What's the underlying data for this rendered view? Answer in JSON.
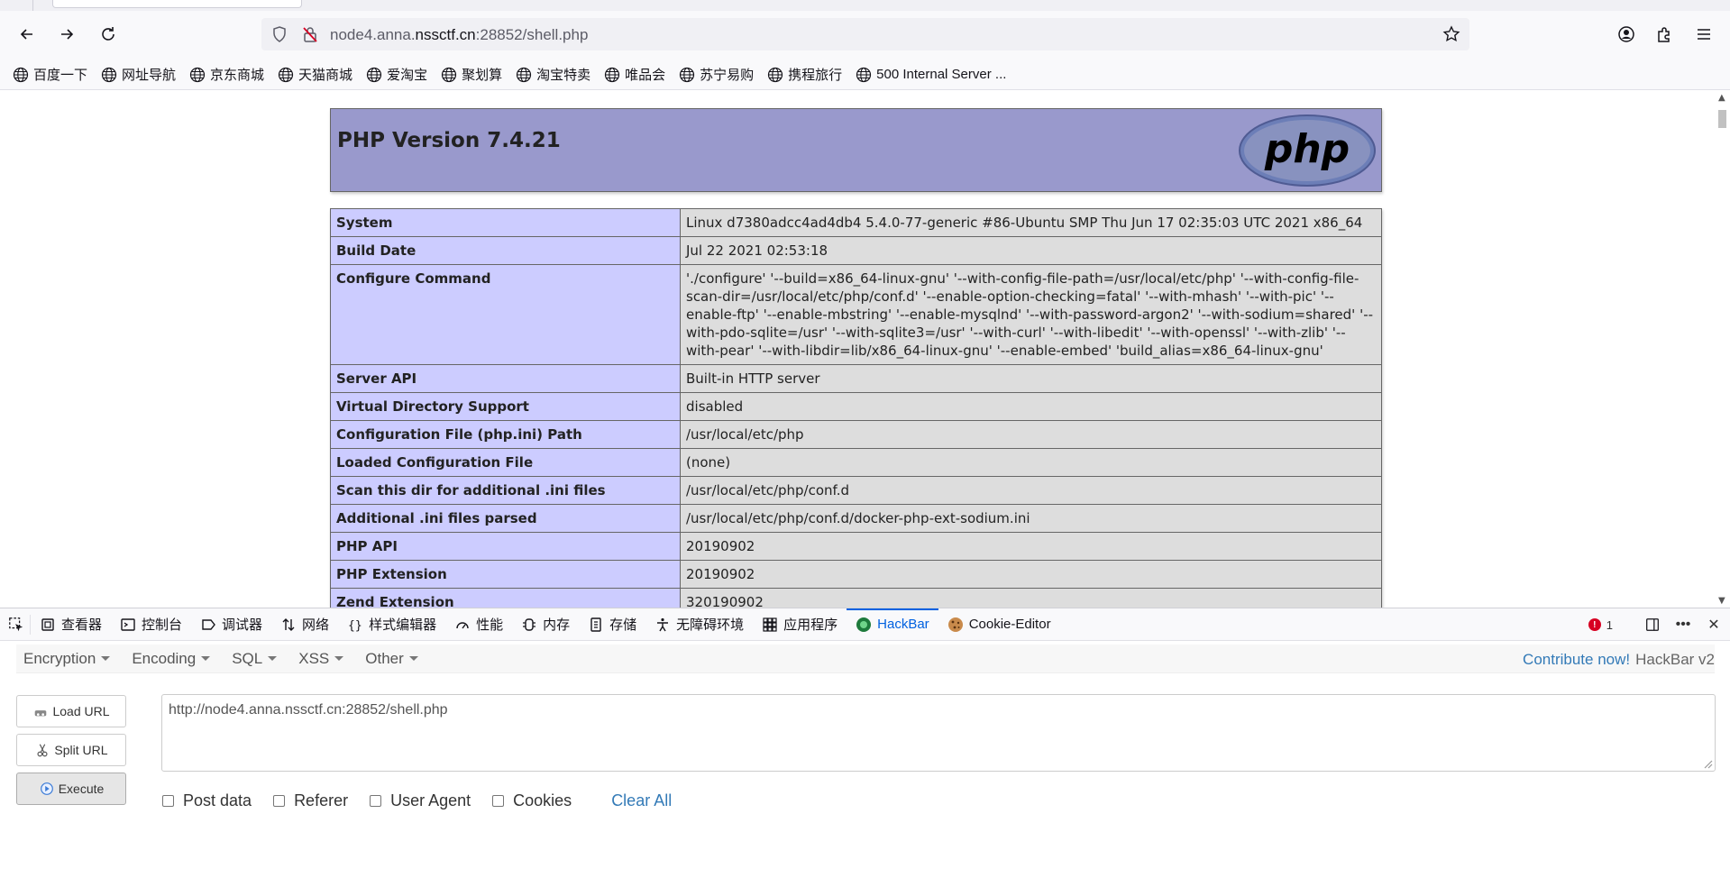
{
  "browser": {
    "url_prefix": "node4.anna.",
    "url_domain": "nssctf.cn",
    "url_suffix": ":28852/shell.php",
    "bookmarks": [
      "百度一下",
      "网址导航",
      "京东商城",
      "天猫商城",
      "爱淘宝",
      "聚划算",
      "淘宝特卖",
      "唯品会",
      "苏宁易购",
      "携程旅行",
      "500 Internal Server ..."
    ]
  },
  "phpinfo": {
    "title": "PHP Version 7.4.21",
    "logo_text": "php",
    "rows": [
      {
        "key": "System",
        "value": "Linux d7380adcc4ad4db4 5.4.0-77-generic #86-Ubuntu SMP Thu Jun 17 02:35:03 UTC 2021 x86_64"
      },
      {
        "key": "Build Date",
        "value": "Jul 22 2021 02:53:18"
      },
      {
        "key": "Configure Command",
        "value": "'./configure' '--build=x86_64-linux-gnu' '--with-config-file-path=/usr/local/etc/php' '--with-config-file-scan-dir=/usr/local/etc/php/conf.d' '--enable-option-checking=fatal' '--with-mhash' '--with-pic' '--enable-ftp' '--enable-mbstring' '--enable-mysqlnd' '--with-password-argon2' '--with-sodium=shared' '--with-pdo-sqlite=/usr' '--with-sqlite3=/usr' '--with-curl' '--with-libedit' '--with-openssl' '--with-zlib' '--with-pear' '--with-libdir=lib/x86_64-linux-gnu' '--enable-embed' 'build_alias=x86_64-linux-gnu'"
      },
      {
        "key": "Server API",
        "value": "Built-in HTTP server"
      },
      {
        "key": "Virtual Directory Support",
        "value": "disabled"
      },
      {
        "key": "Configuration File (php.ini) Path",
        "value": "/usr/local/etc/php"
      },
      {
        "key": "Loaded Configuration File",
        "value": "(none)"
      },
      {
        "key": "Scan this dir for additional .ini files",
        "value": "/usr/local/etc/php/conf.d"
      },
      {
        "key": "Additional .ini files parsed",
        "value": "/usr/local/etc/php/conf.d/docker-php-ext-sodium.ini"
      },
      {
        "key": "PHP API",
        "value": "20190902"
      },
      {
        "key": "PHP Extension",
        "value": "20190902"
      },
      {
        "key": "Zend Extension",
        "value": "320190902"
      }
    ]
  },
  "devtools": {
    "tabs": [
      {
        "label": "查看器",
        "icon": "inspector-icon"
      },
      {
        "label": "控制台",
        "icon": "console-icon"
      },
      {
        "label": "调试器",
        "icon": "debugger-icon"
      },
      {
        "label": "网络",
        "icon": "network-icon"
      },
      {
        "label": "样式编辑器",
        "icon": "style-editor-icon"
      },
      {
        "label": "性能",
        "icon": "performance-icon"
      },
      {
        "label": "内存",
        "icon": "memory-icon"
      },
      {
        "label": "存储",
        "icon": "storage-icon"
      },
      {
        "label": "无障碍环境",
        "icon": "accessibility-icon"
      },
      {
        "label": "应用程序",
        "icon": "application-icon"
      },
      {
        "label": "HackBar",
        "icon": "hackbar-icon"
      },
      {
        "label": "Cookie-Editor",
        "icon": "cookie-icon"
      }
    ],
    "active_tab": "HackBar",
    "error_count": "1"
  },
  "hackbar": {
    "menu": [
      "Encryption",
      "Encoding",
      "SQL",
      "XSS",
      "Other"
    ],
    "contribute": "Contribute now!",
    "version": "HackBar v2",
    "load_url": "Load URL",
    "split_url": "Split URL",
    "execute": "Execute",
    "url_value": "http://node4.anna.nssctf.cn:28852/shell.php",
    "options": [
      "Post data",
      "Referer",
      "User Agent",
      "Cookies"
    ],
    "clear_all": "Clear All"
  },
  "colors": {
    "php_header": "#9999cc",
    "php_key_bg": "#ccccff",
    "php_value_bg": "#dddddd",
    "accent": "#0061e0",
    "link": "#337ab7"
  }
}
